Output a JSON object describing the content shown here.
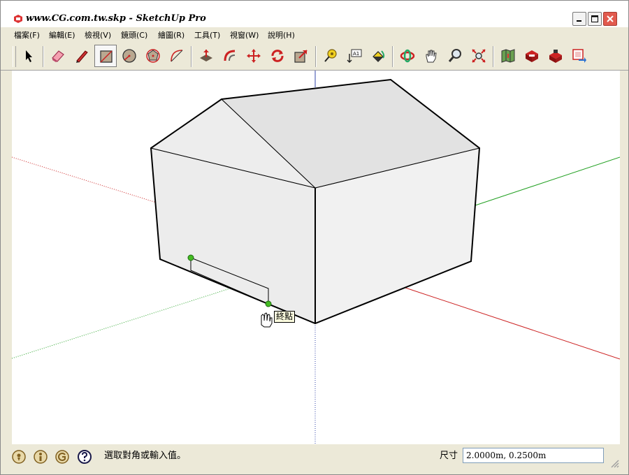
{
  "window": {
    "title": "www.CG.com.tw.skp - SketchUp Pro"
  },
  "menu": [
    {
      "label": "檔案(F)"
    },
    {
      "label": "編輯(E)"
    },
    {
      "label": "檢視(V)"
    },
    {
      "label": "鏡頭(C)"
    },
    {
      "label": "繪圖(R)"
    },
    {
      "label": "工具(T)"
    },
    {
      "label": "視窗(W)"
    },
    {
      "label": "說明(H)"
    }
  ],
  "toolbar": {
    "tools": [
      {
        "name": "select",
        "icon": "arrow-cursor-icon"
      },
      {
        "name": "eraser",
        "icon": "eraser-icon"
      },
      {
        "name": "line",
        "icon": "pencil-icon"
      },
      {
        "name": "rectangle",
        "icon": "rectangle-icon",
        "active": true
      },
      {
        "name": "circle",
        "icon": "circle-icon"
      },
      {
        "name": "polygon",
        "icon": "polygon-icon"
      },
      {
        "name": "arc",
        "icon": "arc-icon"
      },
      {
        "name": "push-pull",
        "icon": "push-pull-icon"
      },
      {
        "name": "follow-me",
        "icon": "follow-me-icon"
      },
      {
        "name": "move",
        "icon": "move-icon"
      },
      {
        "name": "rotate",
        "icon": "rotate-icon"
      },
      {
        "name": "scale",
        "icon": "scale-icon"
      },
      {
        "name": "tape-measure",
        "icon": "tape-measure-icon"
      },
      {
        "name": "text",
        "icon": "text-tool-icon"
      },
      {
        "name": "paint-bucket",
        "icon": "paint-bucket-icon"
      },
      {
        "name": "orbit",
        "icon": "orbit-icon"
      },
      {
        "name": "pan",
        "icon": "pan-hand-icon"
      },
      {
        "name": "zoom",
        "icon": "zoom-icon"
      },
      {
        "name": "zoom-extents",
        "icon": "zoom-extents-icon"
      },
      {
        "name": "google-earth",
        "icon": "map-icon"
      },
      {
        "name": "warehouse-get",
        "icon": "warehouse-get-icon"
      },
      {
        "name": "warehouse-share",
        "icon": "warehouse-share-icon"
      },
      {
        "name": "share-to-earth",
        "icon": "share-arrow-icon"
      }
    ],
    "text_tool_label": "A1"
  },
  "viewport": {
    "tooltip": "終點"
  },
  "status": {
    "message": "選取對角或輸入值。",
    "measurement_label": "尺寸",
    "measurement_value": "2.0000m, 0.2500m",
    "colors": {
      "red_axis": "#cc2222",
      "green_axis": "#22a022",
      "blue_axis": "#3344aa",
      "endpoint": "#44bb22"
    }
  }
}
